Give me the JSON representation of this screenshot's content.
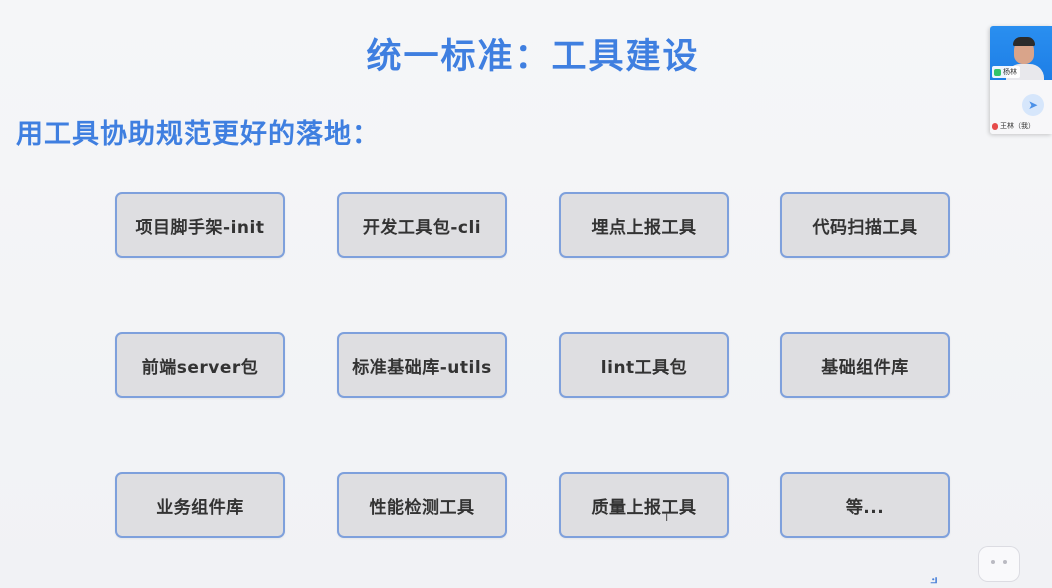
{
  "slide": {
    "title": "统一标准：工具建设",
    "subtitle": "用工具协助规范更好的落地：",
    "tools": [
      "项目脚手架-init",
      "开发工具包-cli",
      "埋点上报工具",
      "代码扫描工具",
      "前端server包",
      "标准基础库-utils",
      "lint工具包",
      "基础组件库",
      "业务组件库",
      "性能检测工具",
      "质量上报工具",
      "等..."
    ]
  },
  "video_call": {
    "remote_name": "杨林",
    "self_name": "王林（我）"
  },
  "colors": {
    "title": "#3f7fe0",
    "box_border": "#7ea0dc",
    "box_fill": "#dedee1",
    "call_blue": "#1d7ee6"
  },
  "icons": [
    "mic-green-icon",
    "mic-red-icon",
    "paper-plane-icon",
    "logo-mark-icon",
    "bilibili-tv-icon"
  ]
}
